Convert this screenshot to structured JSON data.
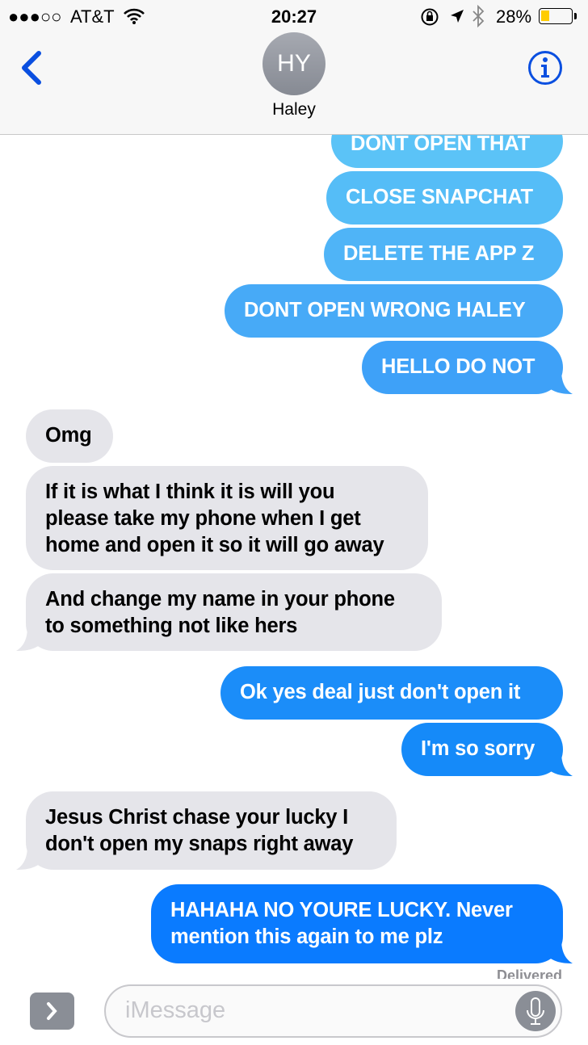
{
  "status_bar": {
    "carrier": "AT&T",
    "signal": "●●●○○",
    "time": "20:27",
    "battery": "28%",
    "battery_level": 0.28
  },
  "header": {
    "avatar_initials": "HY",
    "contact_name": "Haley",
    "back_icon": "chevron-left-icon",
    "info_icon": "info-icon"
  },
  "colors": {
    "incoming": "#e5e5ea",
    "outgoing_top": "#5bc3f7",
    "outgoing_bottom": "#0a7bff",
    "accent": "#0a4fe0"
  },
  "messages": [
    {
      "dir": "out",
      "text": "DONT OPEN THAT",
      "color": "#5bc3f7"
    },
    {
      "dir": "out",
      "text": "CLOSE SNAPCHAT",
      "color": "#55bdf7"
    },
    {
      "dir": "out",
      "text": "DELETE THE APP Z",
      "color": "#4fb4f7"
    },
    {
      "dir": "out",
      "text": "DONT OPEN WRONG HALEY",
      "color": "#47aaf7"
    },
    {
      "dir": "out",
      "text": "HELLO DO NOT",
      "color": "#3ea1f8"
    },
    {
      "dir": "in",
      "text": "Omg"
    },
    {
      "dir": "in",
      "text": "If it is what I think it is will you\nplease take my phone when I get\nhome and open it so it will go away"
    },
    {
      "dir": "in",
      "text": "And change my name in your phone\nto something not like hers"
    },
    {
      "dir": "out",
      "text": "Ok yes deal just don't open it",
      "color": "#1b8df9"
    },
    {
      "dir": "out",
      "text": "I'm so sorry",
      "color": "#158af9"
    },
    {
      "dir": "in",
      "text": "Jesus Christ chase your lucky I\ndon't open my snaps right away"
    },
    {
      "dir": "out",
      "text": "HAHAHA NO YOURE LUCKY. Never\nmention this again to me plz",
      "color": "#0a7bff"
    }
  ],
  "delivered": "Delivered",
  "composer": {
    "placeholder": "iMessage",
    "apps_icon": "chevron-right-icon",
    "mic_icon": "microphone-icon"
  }
}
